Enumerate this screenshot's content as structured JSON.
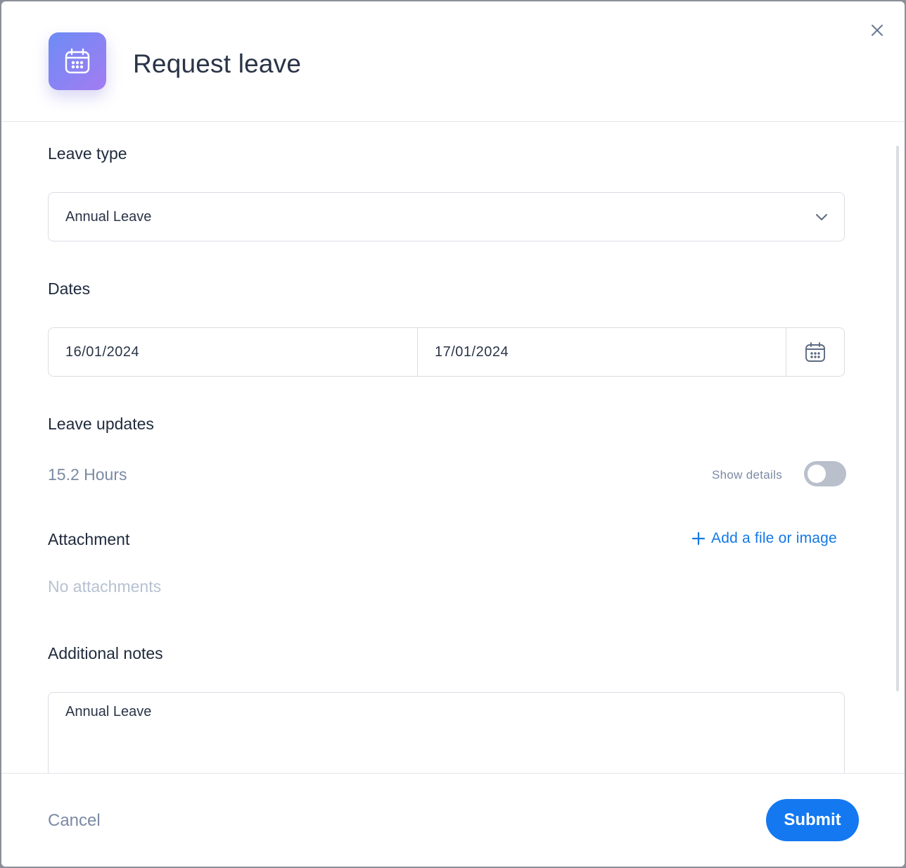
{
  "dialog": {
    "title": "Request leave",
    "header_icon": "calendar-icon",
    "close_icon": "close-icon"
  },
  "leave_type": {
    "label": "Leave type",
    "selected": "Annual Leave",
    "icon": "chevron-down-icon"
  },
  "dates": {
    "label": "Dates",
    "start": "16/01/2024",
    "end": "17/01/2024",
    "icon": "calendar-icon"
  },
  "leave_updates": {
    "label": "Leave updates",
    "hours": "15.2 Hours",
    "show_details_label": "Show details",
    "show_details_on": false
  },
  "attachment": {
    "label": "Attachment",
    "add_label": "Add a file or image",
    "add_icon": "plus-icon",
    "empty_text": "No attachments"
  },
  "notes": {
    "label": "Additional notes",
    "value": "Annual Leave"
  },
  "footer": {
    "cancel_label": "Cancel",
    "submit_label": "Submit"
  },
  "colors": {
    "accent": "#1478f0",
    "link": "#1478e6",
    "muted_text": "#7b8aa3",
    "placeholder_text": "#b7c1d1",
    "toggle_off": "#b9c0cc"
  }
}
